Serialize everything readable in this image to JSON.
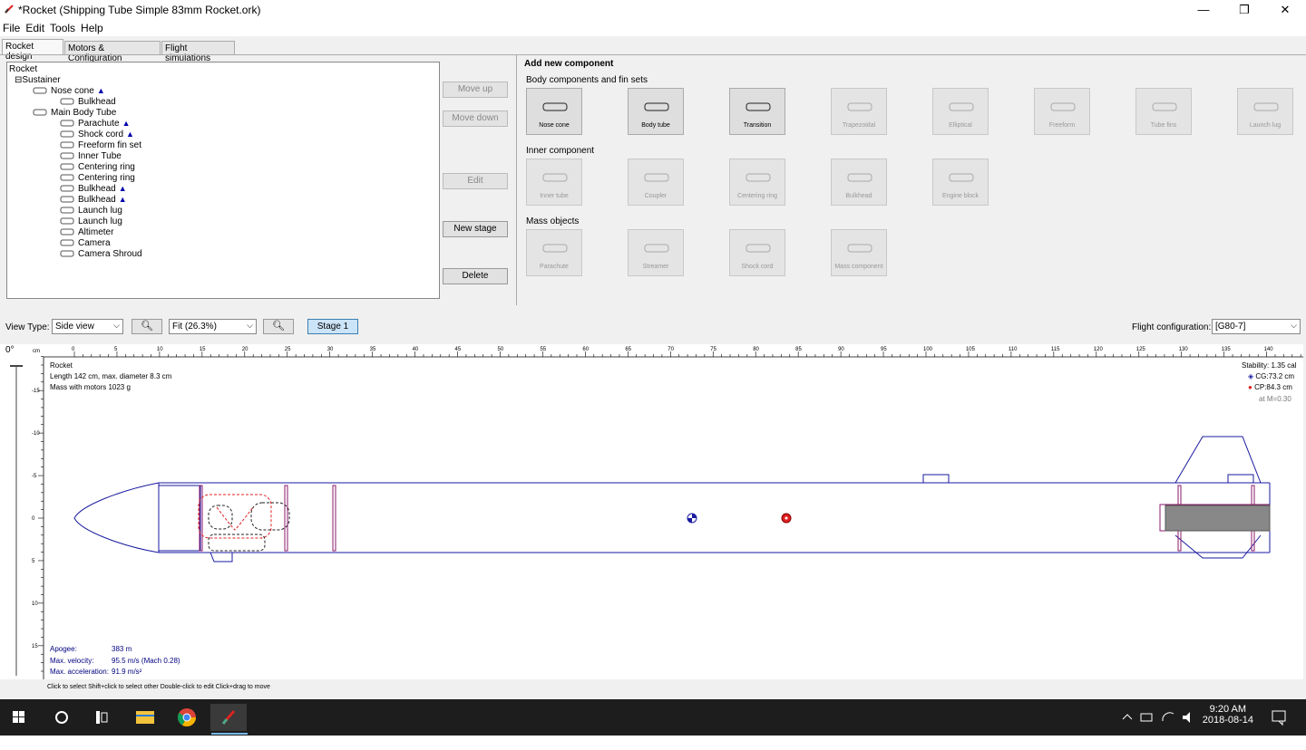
{
  "window": {
    "title": "*Rocket (Shipping Tube Simple 83mm Rocket.ork)",
    "minimize": "—",
    "maximize": "❐",
    "close": "✕"
  },
  "menu": [
    "File",
    "Edit",
    "Tools",
    "Help"
  ],
  "tabs": [
    "Rocket design",
    "Motors & Configuration",
    "Flight simulations"
  ],
  "tree": {
    "root": "Rocket",
    "stage": "Sustainer",
    "items": [
      {
        "label": "Nose cone",
        "icon": "nose-cone-icon",
        "mass": true
      },
      {
        "label": "Bulkhead",
        "icon": "bulkhead-icon",
        "mass": false
      },
      {
        "label": "Main Body Tube",
        "icon": "body-tube-icon",
        "mass": false
      },
      {
        "label": "Parachute",
        "icon": "parachute-icon",
        "mass": true
      },
      {
        "label": "Shock cord",
        "icon": "shock-cord-icon",
        "mass": true
      },
      {
        "label": "Freeform fin set",
        "icon": "freeform-fin-icon",
        "mass": false
      },
      {
        "label": "Inner Tube",
        "icon": "inner-tube-icon",
        "mass": false
      },
      {
        "label": "Centering ring",
        "icon": "centering-ring-icon",
        "mass": false
      },
      {
        "label": "Centering ring",
        "icon": "centering-ring-icon",
        "mass": false
      },
      {
        "label": "Bulkhead",
        "icon": "bulkhead-icon",
        "mass": true
      },
      {
        "label": "Bulkhead",
        "icon": "bulkhead-icon",
        "mass": true
      },
      {
        "label": "Launch lug",
        "icon": "launch-lug-icon",
        "mass": false
      },
      {
        "label": "Launch lug",
        "icon": "launch-lug-icon",
        "mass": false
      },
      {
        "label": "Altimeter",
        "icon": "altimeter-icon",
        "mass": false
      },
      {
        "label": "Camera",
        "icon": "camera-icon",
        "mass": false
      },
      {
        "label": "Camera Shroud",
        "icon": "camera-shroud-icon",
        "mass": false
      }
    ]
  },
  "sidebuttons": {
    "move_up": "Move up",
    "move_down": "Move down",
    "edit": "Edit",
    "new_stage": "New stage",
    "delete": "Delete"
  },
  "add_component": {
    "header": "Add new component",
    "body_section": "Body components and fin sets",
    "inner_section": "Inner component",
    "mass_section": "Mass objects",
    "body": [
      {
        "label": "Nose cone",
        "enabled": true
      },
      {
        "label": "Body tube",
        "enabled": true
      },
      {
        "label": "Transition",
        "enabled": true
      },
      {
        "label": "Trapezoidal",
        "enabled": false
      },
      {
        "label": "Elliptical",
        "enabled": false
      },
      {
        "label": "Freeform",
        "enabled": false
      },
      {
        "label": "Tube fins",
        "enabled": false
      },
      {
        "label": "Launch lug",
        "enabled": false
      }
    ],
    "inner": [
      {
        "label": "Inner tube",
        "enabled": false
      },
      {
        "label": "Coupler",
        "enabled": false
      },
      {
        "label": "Centering ring",
        "enabled": false
      },
      {
        "label": "Bulkhead",
        "enabled": false
      },
      {
        "label": "Engine block",
        "enabled": false
      }
    ],
    "mass": [
      {
        "label": "Parachute",
        "enabled": false
      },
      {
        "label": "Streamer",
        "enabled": false
      },
      {
        "label": "Shock cord",
        "enabled": false
      },
      {
        "label": "Mass component",
        "enabled": false
      }
    ]
  },
  "view": {
    "view_type_label": "View Type:",
    "view_type_value": "Side view",
    "zoom_value": "Fit (26.3%)",
    "stage_button": "Stage 1",
    "flight_config_label": "Flight configuration:",
    "flight_config_value": "[G80-7]",
    "angle": "0°",
    "ruler_unit": "cm"
  },
  "ruler": {
    "top_labels": [
      "0",
      "5",
      "10",
      "15",
      "20",
      "25",
      "30",
      "35",
      "40",
      "45",
      "50",
      "55",
      "60",
      "65",
      "70",
      "75",
      "80",
      "85",
      "90",
      "95",
      "100",
      "105",
      "110",
      "115",
      "120",
      "125",
      "130",
      "135",
      "140"
    ],
    "left_labels": [
      "-15",
      "-10",
      "-5",
      "0",
      "5",
      "10",
      "15"
    ]
  },
  "figure": {
    "name": "Rocket",
    "length": "Length 142 cm, max. diameter 8.3 cm",
    "mass": "Mass with motors 1023 g",
    "stability": "Stability: 1.35 cal",
    "cg": "CG:73.2 cm",
    "cp": "CP:84.3 cm",
    "mach": "at M=0.30",
    "apogee_label": "Apogee:",
    "apogee_value": "383 m",
    "velocity_label": "Max. velocity:",
    "velocity_value": "95.5 m/s  (Mach 0.28)",
    "accel_label": "Max. acceleration:",
    "accel_value": "91.9 m/s²"
  },
  "status": "Click to select    Shift+click to select other    Double-click to edit    Click+drag to move",
  "taskbar": {
    "time": "9:20 AM",
    "date": "2018-08-14"
  },
  "colors": {
    "outline": "#1a1aa0",
    "inner": "#8b1a6b",
    "mass_red": "#e02020",
    "motor": "#888888"
  }
}
